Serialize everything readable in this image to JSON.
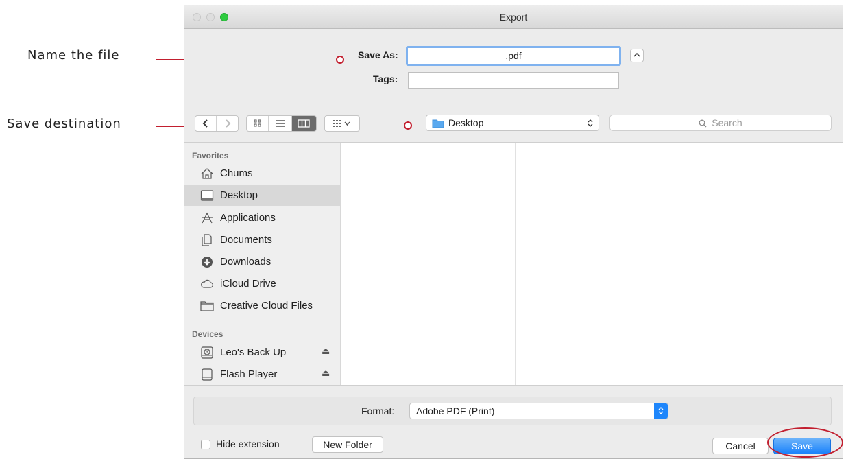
{
  "annotations": {
    "name_the_file": "Name the file",
    "save_destination": "Save destination"
  },
  "window": {
    "title": "Export"
  },
  "save_as": {
    "label": "Save As:",
    "value": ".pdf"
  },
  "tags": {
    "label": "Tags:",
    "value": ""
  },
  "location": {
    "value": "Desktop"
  },
  "search": {
    "placeholder": "Search"
  },
  "sidebar": {
    "favorites_heading": "Favorites",
    "favorites": [
      {
        "label": "Chums",
        "icon": "home-icon"
      },
      {
        "label": "Desktop",
        "icon": "desktop-icon",
        "selected": true
      },
      {
        "label": "Applications",
        "icon": "applications-icon"
      },
      {
        "label": "Documents",
        "icon": "documents-icon"
      },
      {
        "label": "Downloads",
        "icon": "downloads-icon"
      },
      {
        "label": "iCloud Drive",
        "icon": "cloud-icon"
      },
      {
        "label": "Creative Cloud Files",
        "icon": "folder-icon"
      }
    ],
    "devices_heading": "Devices",
    "devices": [
      {
        "label": "Leo's Back Up",
        "icon": "time-machine-icon",
        "eject": "⏏"
      },
      {
        "label": "Flash Player",
        "icon": "disk-icon",
        "eject": "⏏"
      }
    ]
  },
  "format": {
    "label": "Format:",
    "value": "Adobe PDF (Print)"
  },
  "footer": {
    "hide_extension": "Hide extension",
    "new_folder": "New Folder",
    "cancel": "Cancel",
    "save": "Save"
  },
  "colors": {
    "accent": "#1a82fb",
    "annotation": "#c21f2f"
  }
}
